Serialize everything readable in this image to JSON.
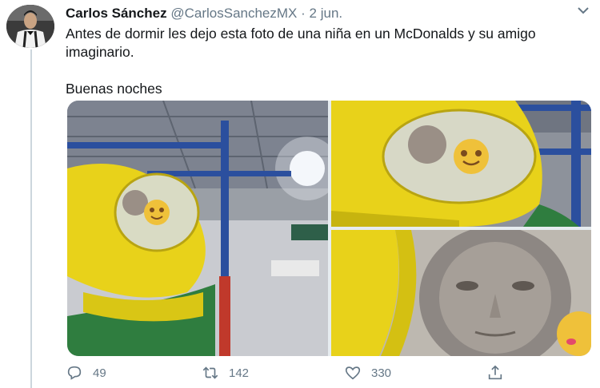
{
  "tweet": {
    "author_name": "Carlos Sánchez",
    "handle": "@CarlosSanchezMX",
    "separator": "·",
    "date": "2 jun.",
    "text_line1": "Antes de dormir les dejo esta foto de una niña en un McDonalds y su amigo imaginario.",
    "text_line2": "Buenas noches"
  },
  "actions": {
    "replies": "49",
    "retweets": "142",
    "likes": "330"
  },
  "colors": {
    "muted": "#657786",
    "tube_yellow": "#e8d21a",
    "pole_blue": "#2b4f9e",
    "pole_red": "#c0392b"
  },
  "icons": [
    "reply-icon",
    "retweet-icon",
    "like-icon",
    "share-icon",
    "chevron-down-icon"
  ]
}
